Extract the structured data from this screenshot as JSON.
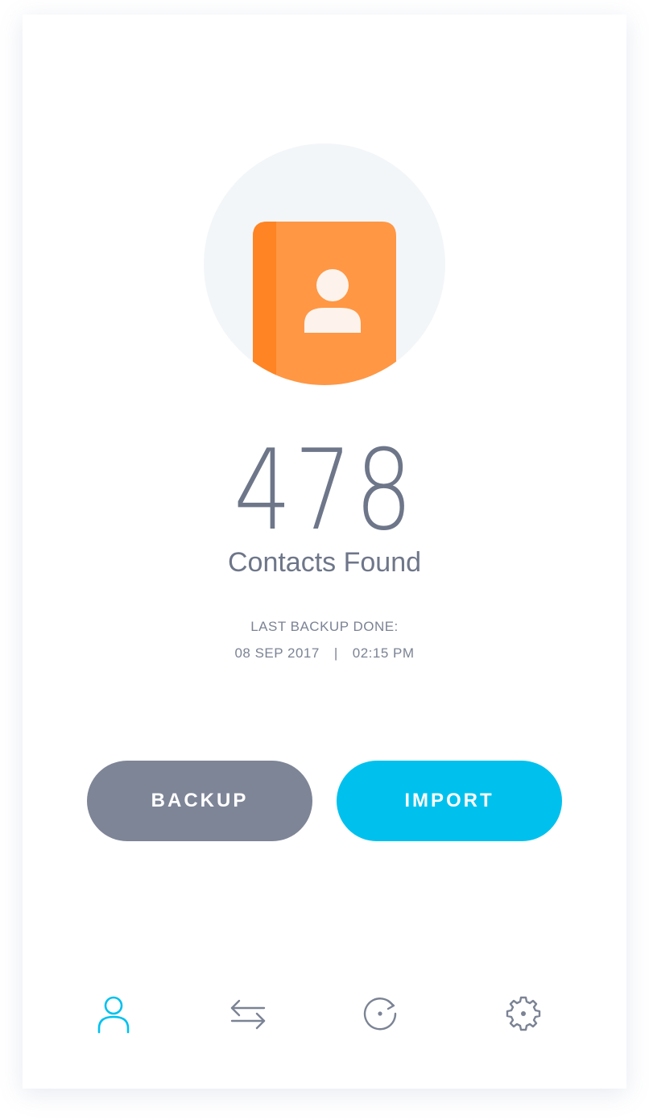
{
  "summary": {
    "contact_count": "478",
    "contacts_label": "Contacts Found",
    "last_backup_label": "LAST BACKUP DONE:",
    "last_backup_date": "08 SEP 2017",
    "separator": "|",
    "last_backup_time": "02:15 PM"
  },
  "actions": {
    "backup_label": "BACKUP",
    "import_label": "IMPORT"
  },
  "hero": {
    "icon": "contact-book-icon"
  },
  "bottom_nav": {
    "items": [
      {
        "icon": "user-icon",
        "active": true
      },
      {
        "icon": "transfer-arrows-icon",
        "active": false
      },
      {
        "icon": "refresh-icon",
        "active": false
      },
      {
        "icon": "gear-icon",
        "active": false
      }
    ]
  },
  "colors": {
    "accent": "#00c1ee",
    "backup_button": "#7e8597",
    "text": "#6e7689",
    "book_orange": "#ff9744",
    "book_spine": "#ff8424",
    "hero_circle": "#f3f6f9",
    "nav_inactive": "#7b8394"
  }
}
